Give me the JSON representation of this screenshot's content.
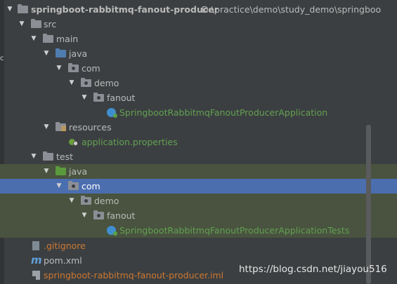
{
  "project": {
    "name": "springboot-rabbitmq-fanout-producer",
    "path": "D:\\practice\\demo\\study_demo\\springboo"
  },
  "tree": {
    "src": "src",
    "main": "main",
    "main_java": "java",
    "main_com": "com",
    "main_demo": "demo",
    "main_fanout": "fanout",
    "app_class": "SpringbootRabbitmqFanoutProducerApplication",
    "resources": "resources",
    "app_properties": "application.properties",
    "test": "test",
    "test_java": "java",
    "test_com": "com",
    "test_demo": "demo",
    "test_fanout": "fanout",
    "test_class": "SpringbootRabbitmqFanoutProducerApplicationTests",
    "gitignore": ".gitignore",
    "pom": "pom.xml",
    "iml": "springboot-rabbitmq-fanout-producer.iml"
  },
  "gutter_mark": "c",
  "watermark": "https://blog.csdn.net/jiayou516",
  "colors": {
    "background": "#3c3f41",
    "selection": "#4b6eaf",
    "test_highlight": "#49533f",
    "resource_file": "#6a8759",
    "ignored_file": "#cc7832"
  }
}
